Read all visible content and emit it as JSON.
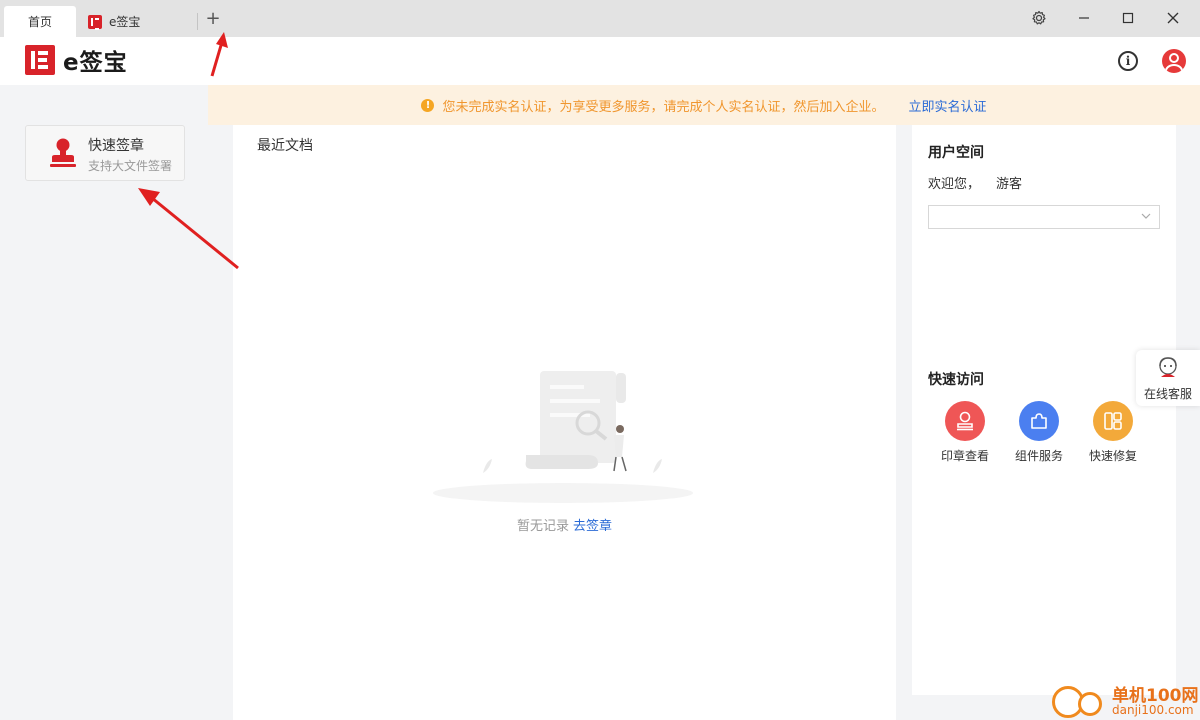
{
  "tabs": [
    {
      "label": "首页",
      "active": true
    },
    {
      "label": "e签宝",
      "active": false
    }
  ],
  "window": {
    "new_tab": "+"
  },
  "brand": {
    "name": "e签宝",
    "color": "#d8232a"
  },
  "header": {
    "info_icon": "i"
  },
  "notice": {
    "icon": "!",
    "text": "您未完成实名认证，为享受更多服务，请完成个人实名认证，然后加入企业。",
    "link": "立即实名认证"
  },
  "quick_sign": {
    "title": "快速签章",
    "subtitle": "支持大文件签署"
  },
  "recent": {
    "title": "最近文档",
    "empty_text": "暂无记录",
    "empty_link": "去签章"
  },
  "user_space": {
    "title": "用户空间",
    "welcome": "欢迎您，",
    "user": "游客",
    "select_value": ""
  },
  "quick_access": {
    "title": "快速访问",
    "items": [
      {
        "label": "印章查看",
        "icon": "stamp-icon",
        "color": "#ef5656"
      },
      {
        "label": "组件服务",
        "icon": "puzzle-icon",
        "color": "#4b7ff0"
      },
      {
        "label": "快速修复",
        "icon": "grid-icon",
        "color": "#f3a93a"
      }
    ]
  },
  "online_service": {
    "label": "在线客服"
  },
  "watermark": {
    "name": "单机100网",
    "url": "danji100.com"
  },
  "colors": {
    "accent": "#d8232a",
    "link": "#2b6bd6",
    "notice_text": "#f0962e",
    "notice_bg": "#fdf1e0"
  }
}
